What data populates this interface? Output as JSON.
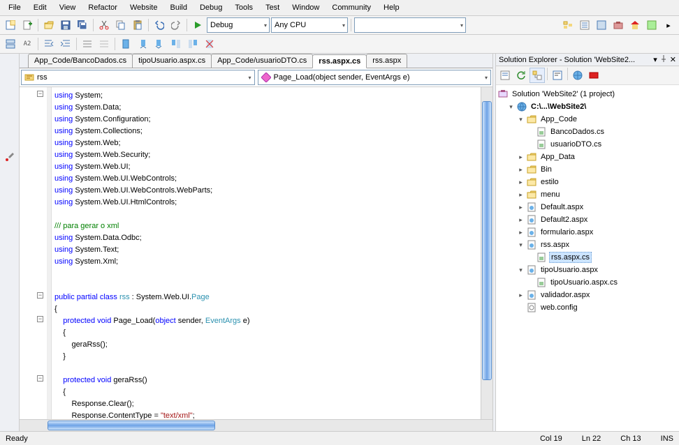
{
  "menu": [
    "File",
    "Edit",
    "View",
    "Refactor",
    "Website",
    "Build",
    "Debug",
    "Tools",
    "Test",
    "Window",
    "Community",
    "Help"
  ],
  "toolbar1": {
    "config": "Debug",
    "platform": "Any CPU"
  },
  "tabs": [
    {
      "label": "App_Code/BancoDados.cs",
      "active": false
    },
    {
      "label": "tipoUsuario.aspx.cs",
      "active": false
    },
    {
      "label": "App_Code/usuarioDTO.cs",
      "active": false
    },
    {
      "label": "rss.aspx.cs",
      "active": true
    },
    {
      "label": "rss.aspx",
      "active": false
    }
  ],
  "combo_left": "rss",
  "combo_right": "Page_Load(object sender, EventArgs e)",
  "explorer": {
    "title": "Solution Explorer - Solution 'WebSite2...",
    "root": "Solution 'WebSite2' (1 project)",
    "project": "C:\\...\\WebSite2\\",
    "items": [
      {
        "label": "App_Code",
        "type": "folder-open",
        "expanded": true,
        "depth": 2,
        "children": [
          {
            "label": "BancoDados.cs",
            "type": "cs",
            "depth": 3
          },
          {
            "label": "usuarioDTO.cs",
            "type": "cs",
            "depth": 3
          }
        ]
      },
      {
        "label": "App_Data",
        "type": "folder",
        "expanded": false,
        "depth": 2
      },
      {
        "label": "Bin",
        "type": "folder",
        "expanded": false,
        "depth": 2
      },
      {
        "label": "estilo",
        "type": "folder",
        "expanded": false,
        "depth": 2
      },
      {
        "label": "menu",
        "type": "folder",
        "expanded": false,
        "depth": 2
      },
      {
        "label": "Default.aspx",
        "type": "aspx",
        "expanded": false,
        "depth": 2
      },
      {
        "label": "Default2.aspx",
        "type": "aspx",
        "expanded": false,
        "depth": 2
      },
      {
        "label": "formulario.aspx",
        "type": "aspx",
        "expanded": false,
        "depth": 2
      },
      {
        "label": "rss.aspx",
        "type": "aspx",
        "expanded": true,
        "depth": 2,
        "children": [
          {
            "label": "rss.aspx.cs",
            "type": "cs",
            "depth": 3,
            "selected": true
          }
        ]
      },
      {
        "label": "tipoUsuario.aspx",
        "type": "aspx",
        "expanded": true,
        "depth": 2,
        "children": [
          {
            "label": "tipoUsuario.aspx.cs",
            "type": "cs",
            "depth": 3
          }
        ]
      },
      {
        "label": "validador.aspx",
        "type": "aspx",
        "expanded": false,
        "depth": 2
      },
      {
        "label": "web.config",
        "type": "config",
        "depth": 2
      }
    ]
  },
  "status": {
    "ready": "Ready",
    "col": "Col 19",
    "ln": "Ln 22",
    "ch": "Ch 13",
    "ins": "INS"
  },
  "code_lines": [
    {
      "t": "using",
      "rest": " System;",
      "chg": true,
      "fold": "minus"
    },
    {
      "t": "using",
      "rest": " System.Data;",
      "chg": true
    },
    {
      "t": "using",
      "rest": " System.Configuration;",
      "chg": true
    },
    {
      "t": "using",
      "rest": " System.Collections;",
      "chg": true
    },
    {
      "t": "using",
      "rest": " System.Web;",
      "chg": true
    },
    {
      "t": "using",
      "rest": " System.Web.Security;",
      "chg": true
    },
    {
      "t": "using",
      "rest": " System.Web.UI;",
      "chg": true
    },
    {
      "t": "using",
      "rest": " System.Web.UI.WebControls;",
      "chg": true
    },
    {
      "t": "using",
      "rest": " System.Web.UI.WebControls.WebParts;",
      "chg": true
    },
    {
      "t": "using",
      "rest": " System.Web.UI.HtmlControls;",
      "chg": true
    },
    {
      "blank": true,
      "chg": true
    },
    {
      "comment": "/// para gerar o xml",
      "chg": true
    },
    {
      "t": "using",
      "rest": " System.Data.Odbc;",
      "chg": true
    },
    {
      "t": "using",
      "rest": " System.Text;",
      "chg": true
    },
    {
      "t": "using",
      "rest": " System.Xml;",
      "chg": true
    },
    {
      "blank": true
    },
    {
      "blank": true
    },
    {
      "class_line": true,
      "fold": "minus"
    },
    {
      "raw": "{"
    },
    {
      "method1": true,
      "fold": "minus"
    },
    {
      "raw": "    {"
    },
    {
      "raw": "        geraRss();"
    },
    {
      "raw": "    }"
    },
    {
      "blank": true
    },
    {
      "method2": true,
      "fold": "minus"
    },
    {
      "raw": "    {"
    },
    {
      "raw": "        Response.Clear();"
    },
    {
      "content_type": true
    },
    {
      "xmlwriter": true
    }
  ]
}
